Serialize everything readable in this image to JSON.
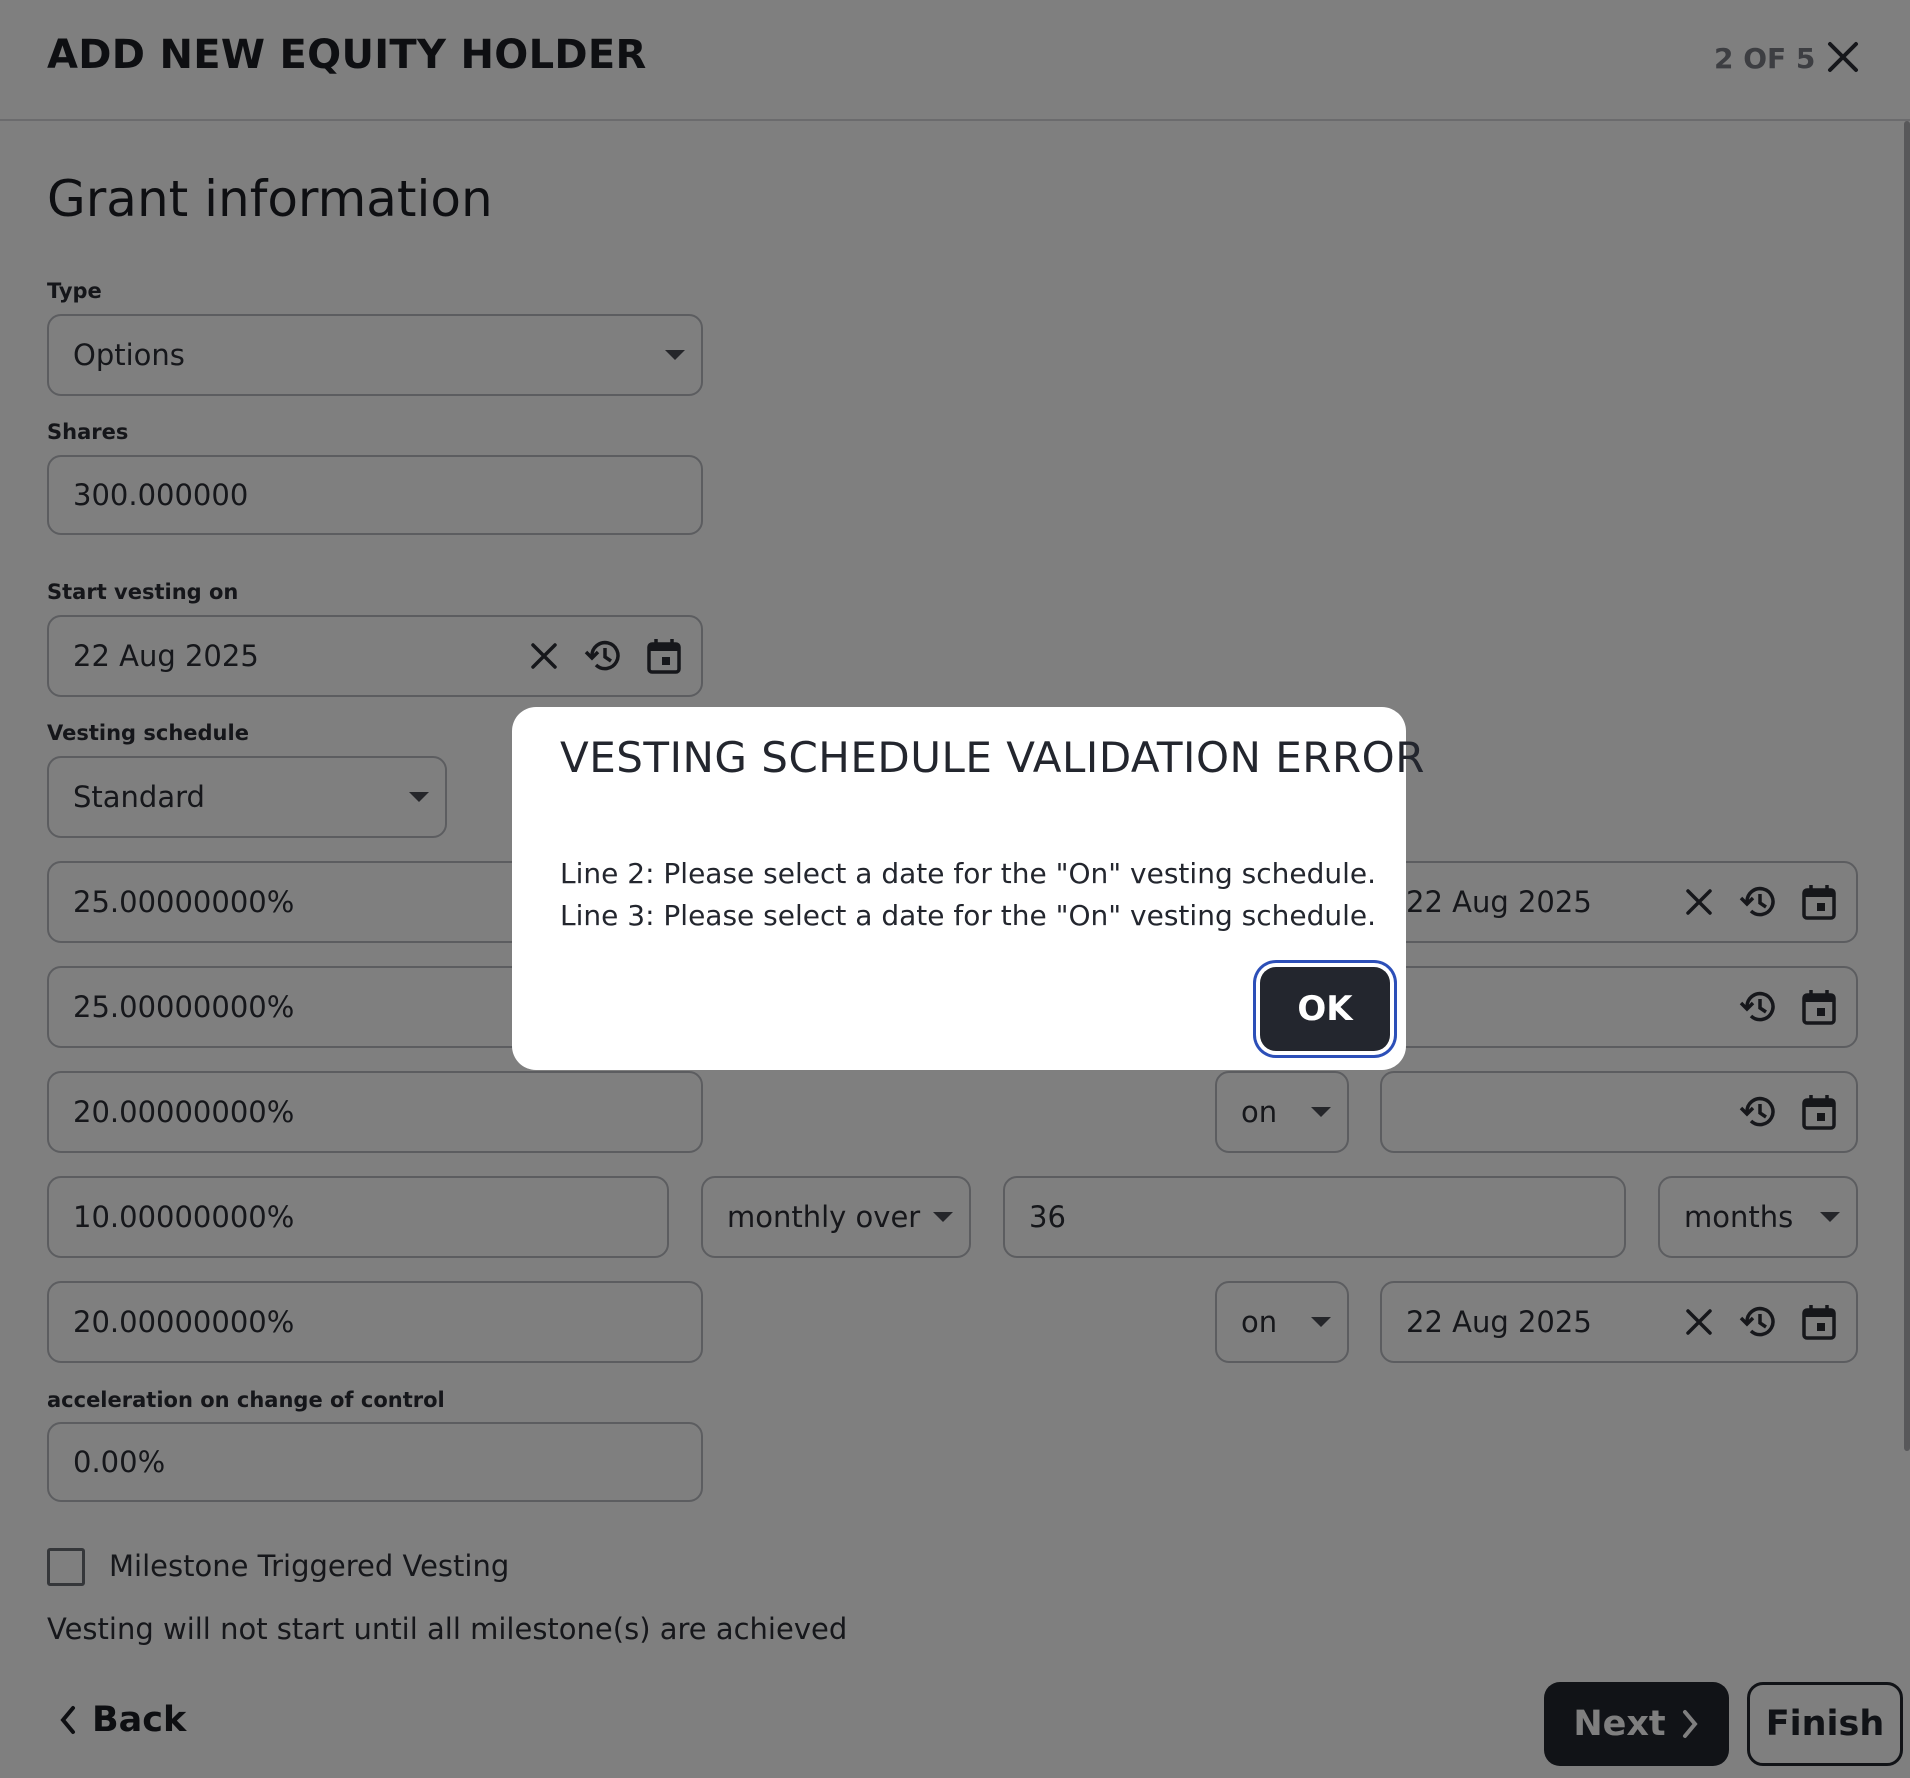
{
  "header": {
    "title": "ADD NEW EQUITY HOLDER",
    "step": "2 OF 5",
    "close_icon": "close-icon"
  },
  "section_title": "Grant information",
  "type": {
    "label": "Type",
    "value": "Options"
  },
  "shares": {
    "label": "Shares",
    "value": "300.000000"
  },
  "start_vesting": {
    "label": "Start vesting on",
    "value": "22 Aug 2025"
  },
  "vesting_schedule": {
    "label": "Vesting schedule",
    "value": "Standard"
  },
  "schedule_rows": [
    {
      "percent": "25.00000000%",
      "date": "22 Aug 2025"
    },
    {
      "percent": "25.00000000%",
      "date": ""
    },
    {
      "percent": "20.00000000%",
      "mode": "on",
      "date": ""
    },
    {
      "percent": "10.00000000%",
      "mode": "monthly over",
      "duration": "36",
      "unit": "months"
    },
    {
      "percent": "20.00000000%",
      "mode": "on",
      "date": "22 Aug 2025"
    }
  ],
  "acceleration": {
    "label": "acceleration on change of control",
    "value": "0.00%"
  },
  "milestone": {
    "label": "Milestone Triggered Vesting",
    "checked": false
  },
  "milestone_note": "Vesting will not start until all milestone(s) are achieved",
  "footer": {
    "back": "Back",
    "next": "Next",
    "finish": "Finish"
  },
  "modal": {
    "title": "VESTING SCHEDULE VALIDATION ERROR",
    "lines": [
      "Line 2: Please select a date for the \"On\" vesting schedule.",
      "Line 3: Please select a date for the \"On\" vesting schedule."
    ],
    "ok": "OK"
  },
  "colors": {
    "dark": "#23262e",
    "overlay": "rgba(0,0,0,0.5)",
    "focus_ring": "#2c4fb8"
  }
}
